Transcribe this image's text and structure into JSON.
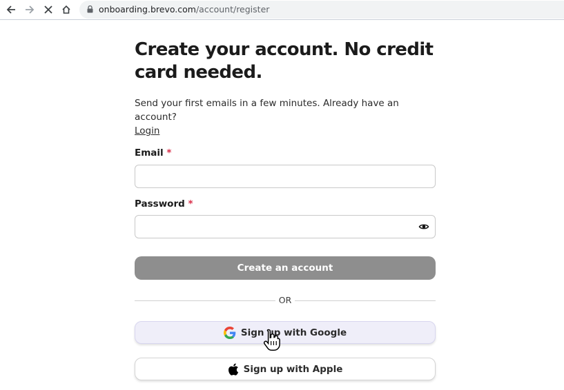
{
  "browser": {
    "url_host": "onboarding.brevo.com",
    "url_path": "/account/register"
  },
  "page": {
    "title": "Create your account. No credit card needed.",
    "subtitle": "Send your first emails in a few minutes. Already have an account?",
    "login_link": "Login"
  },
  "form": {
    "email_label": "Email",
    "password_label": "Password",
    "required_mark": "*",
    "email_value": "",
    "password_value": "",
    "submit_label": "Create an account",
    "divider_text": "OR",
    "google_label": "Sign up with Google",
    "apple_label": "Sign up with Apple"
  },
  "colors": {
    "submit_bg": "#8e8e8e",
    "required": "#d92d48",
    "google_button_bg": "#efeef9"
  },
  "icons": {
    "back": "back-arrow-icon",
    "forward": "forward-arrow-icon",
    "stop": "close-icon",
    "home": "home-icon",
    "lock": "lock-icon",
    "eye": "eye-icon",
    "google": "google-icon",
    "apple": "apple-icon",
    "cursor": "hand-cursor-icon"
  }
}
